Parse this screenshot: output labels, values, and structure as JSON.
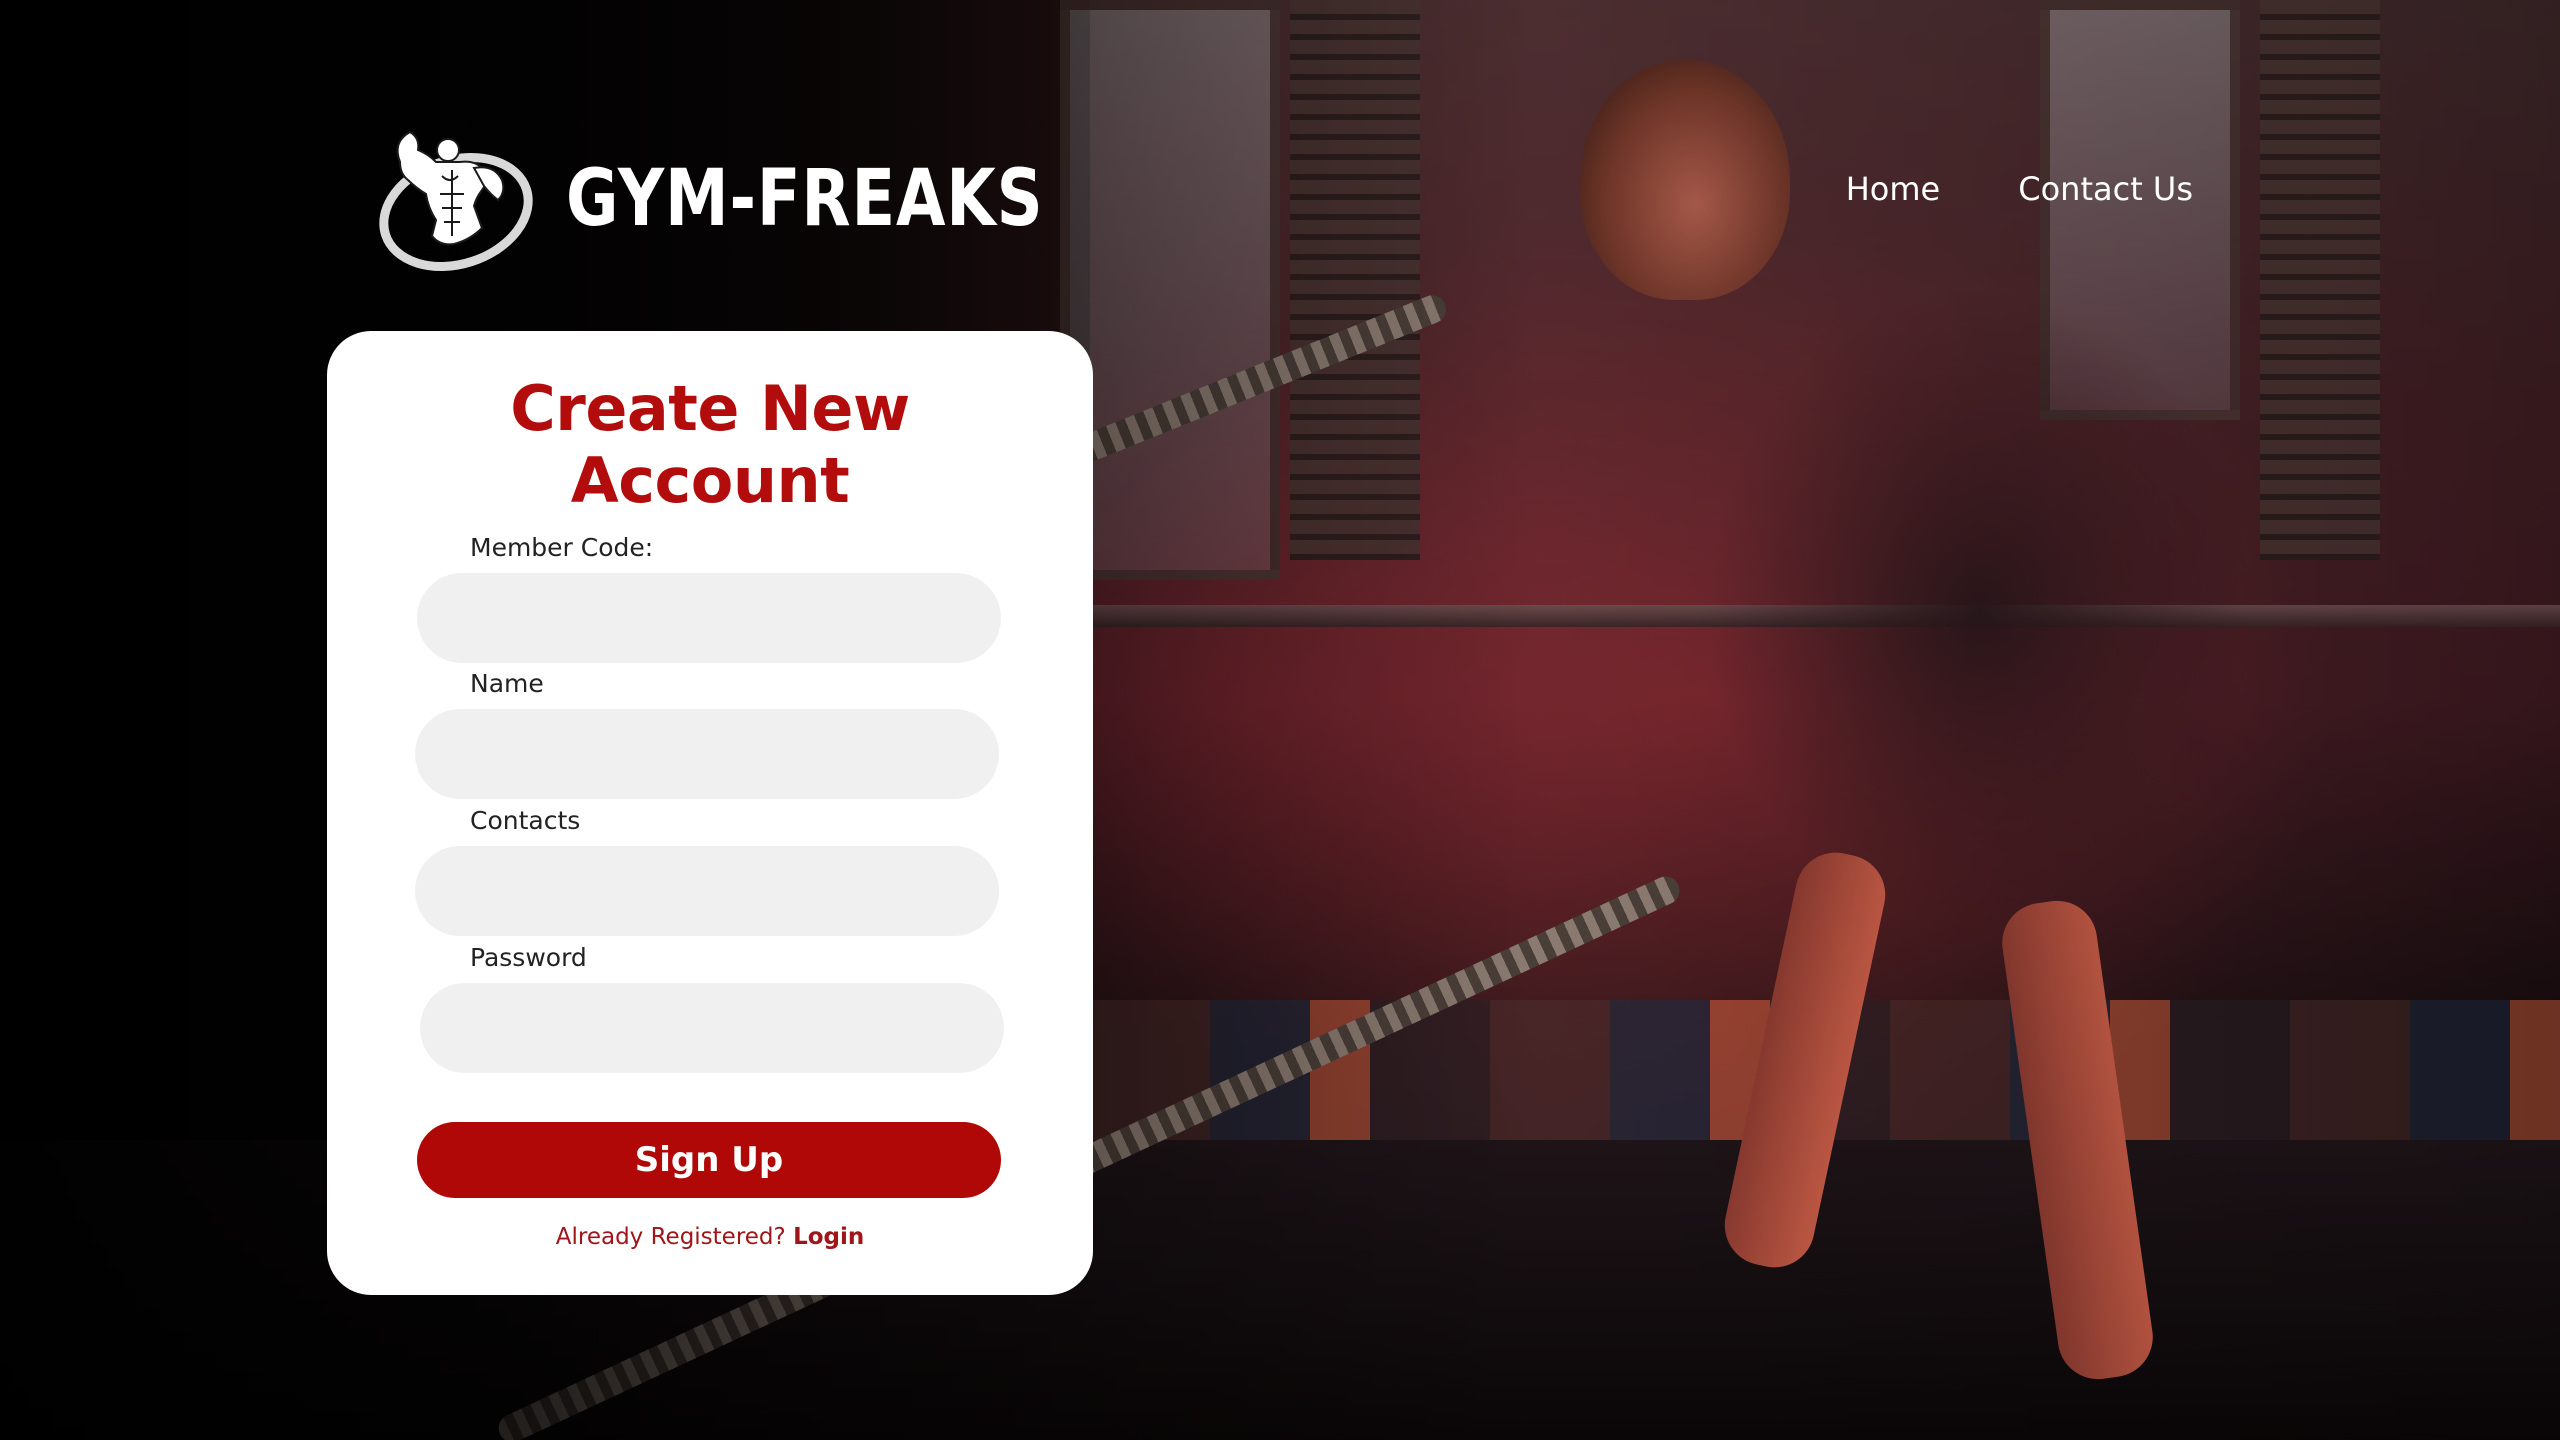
{
  "header": {
    "brand": "GYM-FREAKS",
    "nav": [
      {
        "label": "Home"
      },
      {
        "label": "Contact Us"
      }
    ]
  },
  "form": {
    "title": "Create New Account",
    "fields": [
      {
        "label": "Member Code:",
        "value": "",
        "placeholder": ""
      },
      {
        "label": "Name",
        "value": "",
        "placeholder": ""
      },
      {
        "label": "Contacts",
        "value": "",
        "placeholder": ""
      },
      {
        "label": "Password",
        "value": "",
        "placeholder": ""
      }
    ],
    "submit_label": "Sign Up",
    "login_prompt": "Already Registered?",
    "login_link": "Login"
  },
  "colors": {
    "accent": "#b00707",
    "title_red": "#b30c0c",
    "input_bg": "#f0f0f0",
    "card_bg": "#ffffff"
  },
  "icons": {
    "logo": "bodybuilder-logo-icon"
  }
}
